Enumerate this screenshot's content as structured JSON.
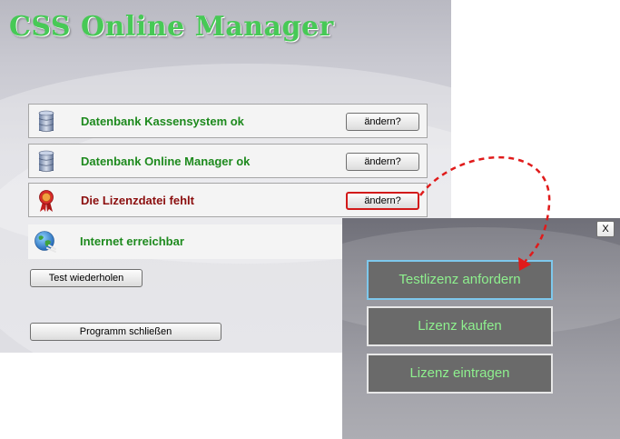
{
  "app": {
    "title": "CSS Online Manager"
  },
  "status_rows": [
    {
      "label": "Datenbank Kassensystem ok",
      "button": "ändern?",
      "state": "ok",
      "icon": "database-icon"
    },
    {
      "label": "Datenbank Online Manager ok",
      "button": "ändern?",
      "state": "ok",
      "icon": "database-icon"
    },
    {
      "label": "Die Lizenzdatei fehlt",
      "button": "ändern?",
      "state": "error",
      "icon": "ribbon-seal-icon"
    },
    {
      "label": "Internet erreichbar",
      "state": "ok",
      "icon": "globe-icon"
    }
  ],
  "actions": {
    "retest": "Test wiederholen",
    "close_program": "Programm schließen"
  },
  "license_dialog": {
    "close_label": "X",
    "buttons": [
      "Testlizenz anfordern",
      "Lizenz kaufen",
      "Lizenz eintragen"
    ]
  },
  "colors": {
    "ok_text": "#1e8a1e",
    "error_text": "#8b0e0e",
    "dialog_button_text": "#8ef08e",
    "highlight": "#d21a1a"
  }
}
